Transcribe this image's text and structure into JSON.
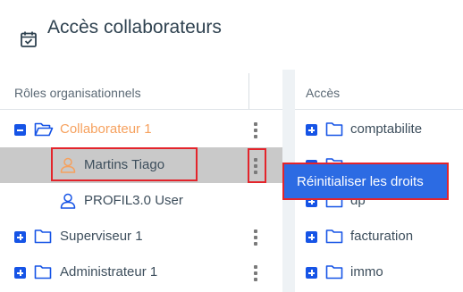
{
  "header": {
    "title": "Accès collaborateurs",
    "icon": "calendar-check-icon"
  },
  "left": {
    "column_title": "Rôles organisationnels",
    "rows": [
      {
        "label": "Collaborateur 1",
        "expander": "minus",
        "icon": "folder-open-icon"
      },
      {
        "label": "Martins Tiago",
        "icon": "user-icon"
      },
      {
        "label": "PROFIL3.0 User",
        "icon": "user-icon"
      },
      {
        "label": "Superviseur 1",
        "expander": "plus",
        "icon": "folder-icon"
      },
      {
        "label": "Administrateur 1",
        "expander": "plus",
        "icon": "folder-icon"
      }
    ]
  },
  "right": {
    "column_title": "Accès",
    "rows": [
      {
        "label": "comptabilite"
      },
      {
        "label": ""
      },
      {
        "label": "dp"
      },
      {
        "label": "facturation"
      },
      {
        "label": "immo"
      }
    ]
  },
  "popup": {
    "label": "Réinitialiser les droits"
  },
  "colors": {
    "accent": "#1654e6",
    "highlight": "#e3242b",
    "orange": "#f6a15e",
    "popup_bg": "#2c6be3"
  }
}
